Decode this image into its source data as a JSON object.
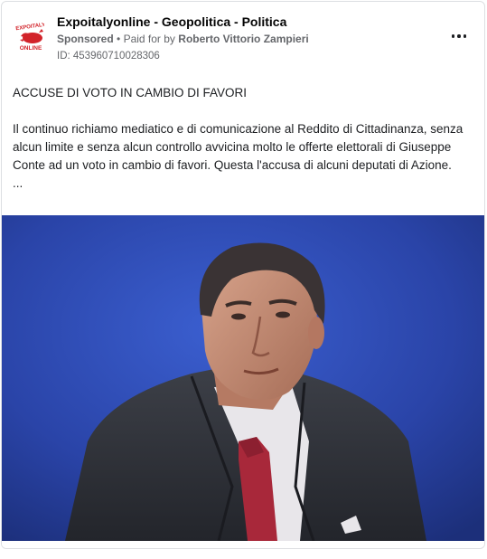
{
  "post": {
    "page_name": "Expoitalyonline - Geopolitica - Politica",
    "sponsored_label": "Sponsored",
    "separator": "•",
    "paid_for_prefix": "Paid for by",
    "paid_for_name": "Roberto Vittorio Zampieri",
    "ad_id": "ID: 453960710028306",
    "more_icon": "more-horizontal-icon",
    "avatar_text_top": "EXPOITALY",
    "avatar_text_bottom": "ONLINE",
    "headline": "ACCUSE DI VOTO IN CAMBIO DI FAVORI",
    "paragraph": "Il continuo richiamo mediatico e di comunicazione al Reddito di Cittadinanza, senza alcun limite e senza alcun controllo avvicina molto le offerte elettorali di Giuseppe Conte ad un voto in cambio di favori. Questa l'accusa di alcuni deputati di Azione.",
    "ellipsis": "...",
    "image_alt": ""
  },
  "colors": {
    "accent_red": "#d2232a",
    "meta_gray": "#65676b",
    "photo_background": "#2a44a8"
  }
}
